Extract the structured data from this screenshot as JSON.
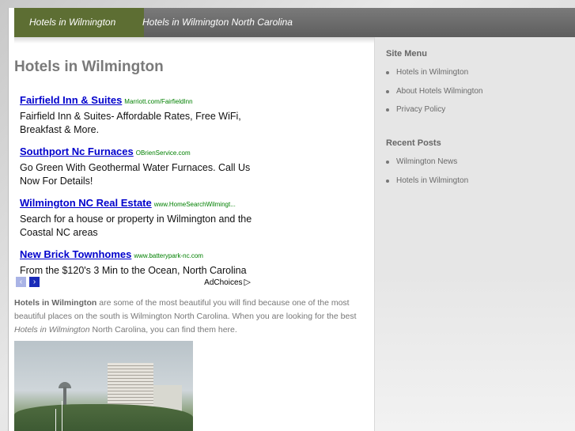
{
  "nav": {
    "tabs": [
      {
        "label": "Hotels in Wilmington",
        "active": true
      },
      {
        "label": "Hotels in Wilmington North Carolina",
        "active": false
      }
    ]
  },
  "main": {
    "title": "Hotels in Wilmington",
    "ads": [
      {
        "title": "Fairfield Inn & Suites",
        "url": "Marriott.com/FairfieldInn",
        "desc": "Fairfield Inn & Suites- Affordable Rates, Free WiFi, Breakfast & More."
      },
      {
        "title": "Southport Nc Furnaces",
        "url": "OBrienService.com",
        "desc": "Go Green With Geothermal Water Furnaces. Call Us Now For Details!"
      },
      {
        "title": "Wilmington NC Real Estate",
        "url": "www.HomeSearchWilmingt...",
        "desc": "Search for a house or property in Wilmington and the Coastal NC areas"
      },
      {
        "title": "New Brick Townhomes",
        "url": "www.batterypark-nc.com",
        "desc": "From the $120's 3 Min to the Ocean, North Carolina"
      }
    ],
    "ad_nav": {
      "prev": "‹",
      "next": "›",
      "adchoices": "AdChoices",
      "adchoices_icon": "▷"
    },
    "body": {
      "bold_lead": "Hotels in Wilmington",
      "part1": " are some of the most beautiful you will find because one of the most beautiful places on the south is Wilmington North Carolina.  When you are looking for the best ",
      "italic": "Hotels in Wilmington",
      "part2": " North Carolina, you can find them here."
    }
  },
  "sidebar": {
    "site_menu_heading": "Site Menu",
    "site_menu": [
      "Hotels in Wilmington",
      "About Hotels Wilmington",
      "Privacy Policy"
    ],
    "recent_heading": "Recent Posts",
    "recent": [
      "Wilmington News",
      "Hotels in Wilmington"
    ]
  },
  "colors": {
    "nav_active": "#5d6e33",
    "nav_bg": "#6b6b6b",
    "ad_link": "#0000cc",
    "ad_url": "#008000"
  }
}
